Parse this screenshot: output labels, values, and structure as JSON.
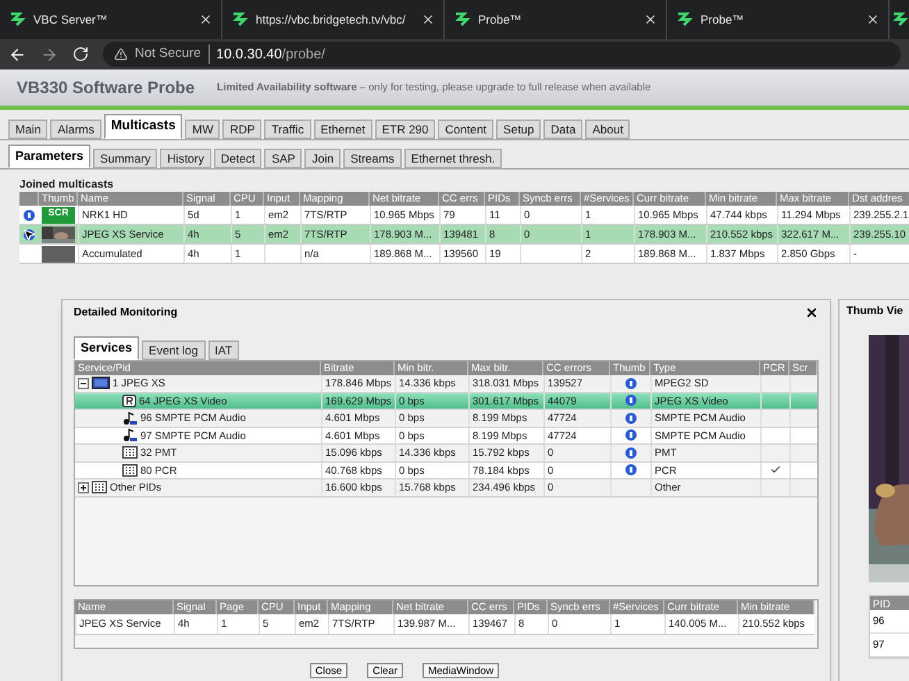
{
  "browser_tabs": [
    {
      "title": "VBC Server™"
    },
    {
      "title": "https://vbc.bridgetech.tv/vbc/"
    },
    {
      "title": "Probe™"
    },
    {
      "title": "Probe™"
    }
  ],
  "address": {
    "security": "Not Secure",
    "host": "10.0.30.40",
    "path": "/probe/"
  },
  "app": {
    "title": "VB330 Software Probe",
    "notice": "**Limited Availability software** – only for testing, please upgrade to full release when available"
  },
  "main_tabs": [
    {
      "label": "Main",
      "selected": false
    },
    {
      "label": "Alarms",
      "selected": false
    },
    {
      "label": "Multicasts",
      "selected": true
    },
    {
      "label": "MW",
      "selected": false
    },
    {
      "label": "RDP",
      "selected": false
    },
    {
      "label": "Traffic",
      "selected": false
    },
    {
      "label": "Ethernet",
      "selected": false
    },
    {
      "label": "ETR 290",
      "selected": false
    },
    {
      "label": "Content",
      "selected": false
    },
    {
      "label": "Setup",
      "selected": false
    },
    {
      "label": "Data",
      "selected": false
    },
    {
      "label": "About",
      "selected": false
    }
  ],
  "sub_tabs": [
    {
      "label": "Parameters",
      "selected": true
    },
    {
      "label": "Summary",
      "selected": false
    },
    {
      "label": "History",
      "selected": false
    },
    {
      "label": "Detect",
      "selected": false
    },
    {
      "label": "SAP",
      "selected": false
    },
    {
      "label": "Join",
      "selected": false
    },
    {
      "label": "Streams",
      "selected": false
    },
    {
      "label": "Ethernet thresh.",
      "selected": false
    }
  ],
  "joined_multicasts": {
    "title": "Joined multicasts",
    "thumb_header": "Thumb",
    "columns": [
      "Name",
      "Signal",
      "CPU",
      "Input",
      "Mapping",
      "Net bitrate",
      "CC errs",
      "PIDs",
      "Syncb errs",
      "#Services",
      "Curr bitrate",
      "Min bitrate",
      "Max bitrate",
      "Dst addres"
    ],
    "rows": [
      {
        "info": true,
        "selected": false,
        "thumb": {
          "kind": "badge",
          "text": "SCR"
        },
        "cells": [
          "NRK1 HD",
          "5d",
          "1",
          "em2",
          "7TS/RTP",
          "10.965 Mbps",
          "79",
          "11",
          "0",
          "1",
          "10.965 Mbps",
          "47.744 kbps",
          "11.294 Mbps",
          "239.255.2.1"
        ]
      },
      {
        "info": true,
        "selected": true,
        "cells": [
          "JPEG XS Service",
          "4h",
          "5",
          "em2",
          "7TS/RTP",
          "178.903 M...",
          "139481",
          "8",
          "0",
          "1",
          "178.903 M...",
          "210.552 kbps",
          "322.617 M...",
          "239.255.10"
        ]
      },
      {
        "info": false,
        "selected": false,
        "thumb": {
          "kind": "blank"
        },
        "cells": [
          "Accumulated",
          "4h",
          "1",
          "",
          "n/a",
          "189.868 M...",
          "139560",
          "19",
          "",
          "2",
          "189.868 M...",
          "1.837 Mbps",
          "2.850 Gbps",
          "-"
        ]
      }
    ]
  },
  "dialog": {
    "title": "Detailed Monitoring",
    "tabs": [
      {
        "label": "Services",
        "selected": true
      },
      {
        "label": "Event log",
        "selected": false
      },
      {
        "label": "IAT",
        "selected": false
      }
    ],
    "columns": [
      "Service/Pid",
      "Bitrate",
      "Min bitr.",
      "Max bitr.",
      "CC errors",
      "Thumb",
      "Type",
      "PCR",
      "Scr"
    ],
    "services": [
      {
        "kind": "service",
        "expanded": true,
        "selected": false,
        "info": true,
        "pcr": false,
        "cells": [
          "1 JPEG XS",
          "178.846 Mbps",
          "14.336 kbps",
          "318.031 Mbps",
          "139527",
          "MPEG2 SD"
        ],
        "children": [
          {
            "kind": "video",
            "selected": true,
            "info": true,
            "pcr": false,
            "cells": [
              "64 JPEG XS Video",
              "169.629 Mbps",
              "0 bps",
              "301.617 Mbps",
              "44079",
              "JPEG XS Video"
            ]
          },
          {
            "kind": "audio",
            "selected": false,
            "info": true,
            "pcr": false,
            "cells": [
              "96 SMPTE PCM Audio",
              "4.601 Mbps",
              "0 bps",
              "8.199 Mbps",
              "47724",
              "SMPTE PCM Audio"
            ]
          },
          {
            "kind": "audio",
            "selected": false,
            "info": true,
            "pcr": false,
            "cells": [
              "97 SMPTE PCM Audio",
              "4.601 Mbps",
              "0 bps",
              "8.199 Mbps",
              "47724",
              "SMPTE PCM Audio"
            ]
          },
          {
            "kind": "table",
            "selected": false,
            "info": true,
            "pcr": false,
            "cells": [
              "32 PMT",
              "15.096 kbps",
              "14.336 kbps",
              "15.792 kbps",
              "0",
              "PMT"
            ]
          },
          {
            "kind": "table",
            "selected": false,
            "info": true,
            "pcr": true,
            "cells": [
              "80 PCR",
              "40.768 kbps",
              "0 bps",
              "78.184 kbps",
              "0",
              "PCR"
            ]
          }
        ]
      },
      {
        "kind": "table",
        "expanded": false,
        "selected": false,
        "info": false,
        "pcr": false,
        "cells": [
          "Other PIDs",
          "16.600 kbps",
          "15.768 kbps",
          "234.496 kbps",
          "0",
          "Other"
        ]
      }
    ],
    "detail_columns": [
      "Name",
      "Signal",
      "Page",
      "CPU",
      "Input",
      "Mapping",
      "Net bitrate",
      "CC errs",
      "PIDs",
      "Syncb errs",
      "#Services",
      "Curr bitrate",
      "Min bitrate"
    ],
    "detail_rows": [
      [
        "JPEG XS Service",
        "4h",
        "1",
        "5",
        "em2",
        "7TS/RTP",
        "139.987 M...",
        "139467",
        "8",
        "0",
        "1",
        "140.005 M...",
        "210.552 kbps"
      ]
    ],
    "buttons": [
      "Close",
      "Clear",
      "MediaWindow"
    ]
  },
  "thumb_view": {
    "title": "Thumb Vie",
    "column": "PID",
    "rows": [
      "96",
      "97"
    ]
  }
}
